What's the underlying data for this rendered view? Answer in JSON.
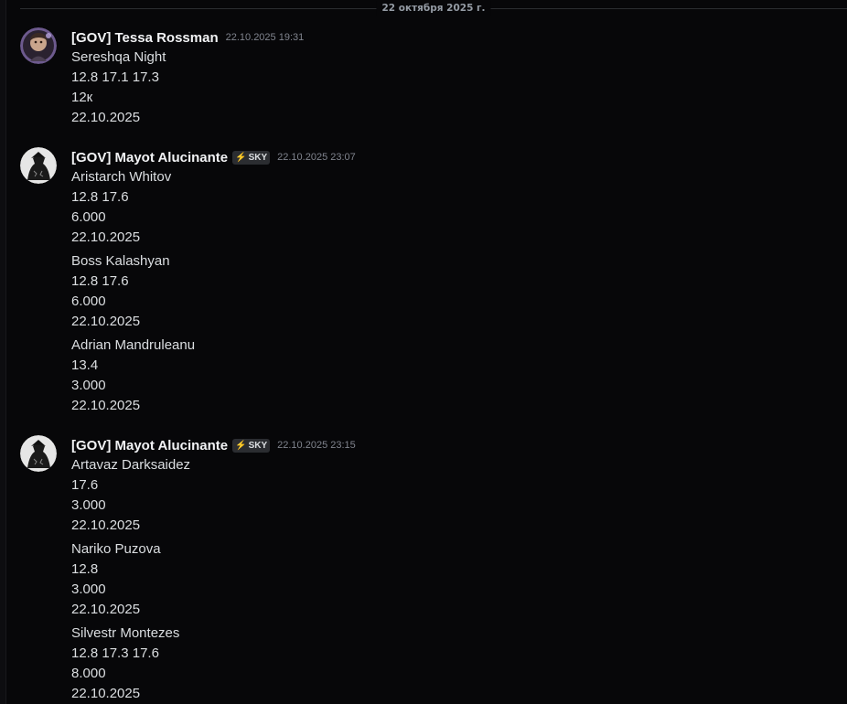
{
  "divider": {
    "date": "22 октября 2025 г."
  },
  "messages": [
    {
      "username": "[GOV] Tessa Rossman",
      "tag": "",
      "timestamp": "22.10.2025 19:31",
      "blocks": [
        [
          "Sereshqa Night",
          "12.8 17.1 17.3",
          "12к",
          "22.10.2025"
        ]
      ]
    },
    {
      "username": "[GOV] Mayot Alucinante",
      "tag": "SKY",
      "timestamp": "22.10.2025 23:07",
      "blocks": [
        [
          "Aristarch Whitov",
          "12.8 17.6",
          "6.000",
          "22.10.2025"
        ],
        [
          "Boss Kalashyan",
          "12.8 17.6",
          "6.000",
          "22.10.2025"
        ],
        [
          "Adrian Mandruleanu",
          "13.4",
          "3.000",
          "22.10.2025"
        ]
      ]
    },
    {
      "username": "[GOV] Mayot Alucinante",
      "tag": "SKY",
      "timestamp": "22.10.2025 23:15",
      "blocks": [
        [
          "Artavaz Darksaidez",
          "17.6",
          "3.000",
          "22.10.2025"
        ],
        [
          "Nariko Puzova",
          "12.8",
          "3.000",
          "22.10.2025"
        ],
        [
          "Silvestr Montezes",
          "12.8 17.3 17.6",
          "8.000",
          "22.10.2025"
        ]
      ]
    }
  ],
  "icons": {
    "tag_bolt": "lightning-bolt-icon"
  },
  "colors": {
    "background": "#070709",
    "username": "#f2f3f5",
    "text": "#dbdee1",
    "timestamp": "#80848e",
    "divider": "#2b2d31"
  }
}
